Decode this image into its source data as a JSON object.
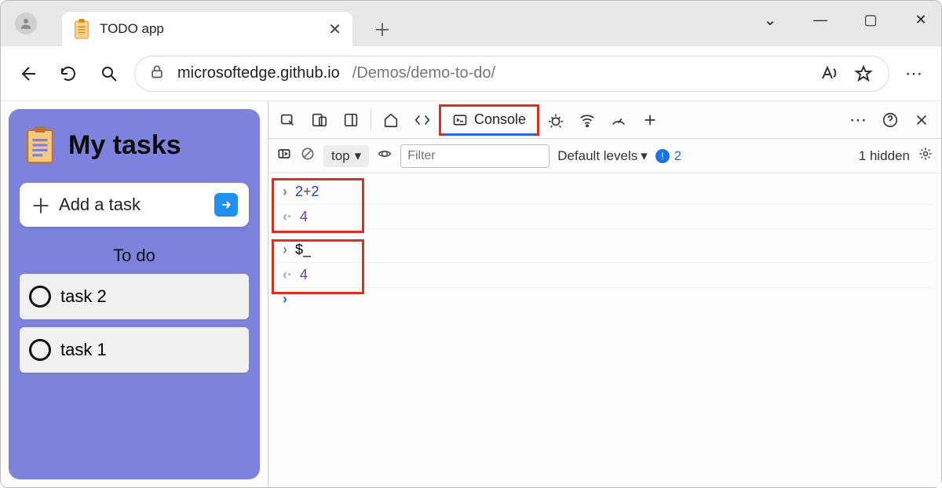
{
  "browser": {
    "tab_title": "TODO app",
    "url_host": "microsoftedge.github.io",
    "url_path": "/Demos/demo-to-do/"
  },
  "todo": {
    "title": "My tasks",
    "add_label": "Add a task",
    "section": "To do",
    "tasks": [
      "task 2",
      "task 1"
    ]
  },
  "devtools": {
    "active_tab": "Console",
    "context": "top",
    "filter_placeholder": "Filter",
    "levels": "Default levels",
    "issues_count": "2",
    "hidden": "1 hidden",
    "console": {
      "line1_input_a": "2",
      "line1_input_op": "+",
      "line1_input_b": "2",
      "line1_output": "4",
      "line2_input": "$_",
      "line2_output": "4"
    }
  }
}
